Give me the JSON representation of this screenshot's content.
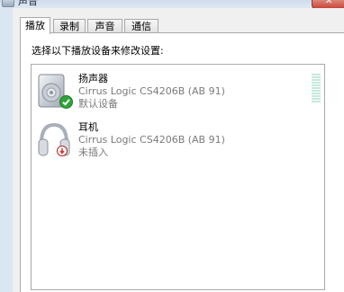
{
  "window": {
    "title": "声音",
    "close_glyph": "✕"
  },
  "tabs": [
    {
      "label": "播放",
      "active": true
    },
    {
      "label": "录制",
      "active": false
    },
    {
      "label": "声音",
      "active": false
    },
    {
      "label": "通信",
      "active": false
    }
  ],
  "panel": {
    "instruction": "选择以下播放设备来修改设置:"
  },
  "devices": [
    {
      "name": "扬声器",
      "description": "Cirrus Logic CS4206B (AB 91)",
      "status": "默认设备",
      "icon": "speaker-icon",
      "badge": "default-check-icon",
      "badge_color": "#2fa33a"
    },
    {
      "name": "耳机",
      "description": "Cirrus Logic CS4206B (AB 91)",
      "status": "未插入",
      "icon": "headphones-icon",
      "badge": "unplugged-icon",
      "badge_color": "#d23a3a"
    }
  ]
}
